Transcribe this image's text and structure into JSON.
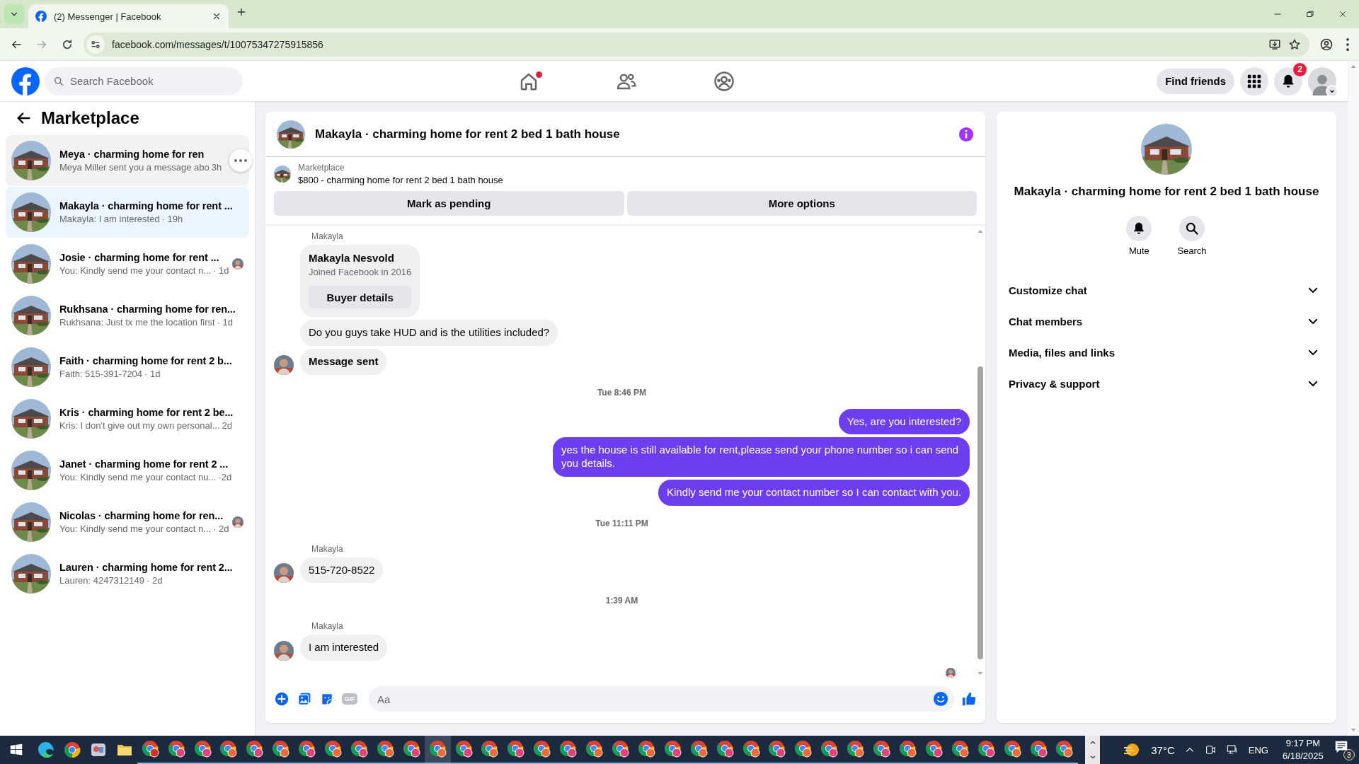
{
  "browser": {
    "tab_title": "(2) Messenger | Facebook",
    "url": "facebook.com/messages/t/10075347275915856"
  },
  "header": {
    "search_placeholder": "Search Facebook",
    "nav": [
      {
        "kind": "home",
        "selected": false,
        "dot": true
      },
      {
        "kind": "friends",
        "selected": false,
        "dot": false
      },
      {
        "kind": "groups",
        "selected": false,
        "dot": false
      }
    ],
    "find_friends": "Find friends",
    "notification_count": "2"
  },
  "sidebar": {
    "title": "Marketplace",
    "conversations": [
      {
        "title": "Meya · charming home for ren",
        "preview": "Meya Miller sent you a message abo",
        "time": "3h",
        "selected": false,
        "hovered": true,
        "seen_avatar": false
      },
      {
        "title": "Makayla · charming home for rent ...",
        "preview": "Makayla: I am interested",
        "time": "· 19h",
        "selected": true,
        "hovered": false,
        "seen_avatar": false
      },
      {
        "title": "Josie · charming home for rent ...",
        "preview": "You: Kindly send me your contact n...",
        "time": "· 1d",
        "selected": false,
        "hovered": false,
        "seen_avatar": true
      },
      {
        "title": "Rukhsana · charming home for ren...",
        "preview": "Rukhsana: Just tx me the location first",
        "time": "· 1d",
        "selected": false,
        "hovered": false,
        "seen_avatar": false
      },
      {
        "title": "Faith · charming home for rent 2 b...",
        "preview": "Faith: 515-391-7204",
        "time": "· 1d",
        "selected": false,
        "hovered": false,
        "seen_avatar": false
      },
      {
        "title": "Kris · charming home for rent 2 be...",
        "preview": "Kris: I don't give out my own personal...",
        "time": "2d",
        "selected": false,
        "hovered": false,
        "seen_avatar": false
      },
      {
        "title": "Janet · charming home for rent 2 ...",
        "preview": "You: Kindly send me your contact nu...",
        "time": "·2d",
        "selected": false,
        "hovered": false,
        "seen_avatar": false
      },
      {
        "title": "Nicolas · charming home for ren...",
        "preview": "You: Kindly send me your contact n...",
        "time": "· 2d",
        "selected": false,
        "hovered": false,
        "seen_avatar": true
      },
      {
        "title": "Lauren · charming home for rent 2...",
        "preview": "Lauren: 4247312149",
        "time": "· 2d",
        "selected": false,
        "hovered": false,
        "seen_avatar": false
      }
    ]
  },
  "chat": {
    "title": "Makayla · charming home for rent 2 bed 1 bath house",
    "listing": {
      "label": "Marketplace",
      "text": "$800 - charming home for rent 2 bed 1 bath house"
    },
    "actions": [
      "Mark as pending",
      "More options"
    ],
    "messages": [
      {
        "kind": "sender",
        "text": "Makayla"
      },
      {
        "kind": "profile_card",
        "name": "Makayla Nesvold",
        "detail": "Joined Facebook in 2016",
        "button": "Buyer details"
      },
      {
        "kind": "incoming",
        "text": "Do you guys take HUD and is the utilities included?",
        "avatar": false,
        "bold": false
      },
      {
        "kind": "incoming",
        "text": "Message sent",
        "avatar": true,
        "bold": true
      },
      {
        "kind": "time",
        "text": "Tue 8:46 PM"
      },
      {
        "kind": "outgoing",
        "text": "Yes, are you interested?"
      },
      {
        "kind": "outgoing",
        "text": "yes the house is still available for rent,please send your phone number so i can send you details."
      },
      {
        "kind": "outgoing",
        "text": "Kindly send me your contact number so I can contact with you."
      },
      {
        "kind": "time",
        "text": "Tue 11:11 PM"
      },
      {
        "kind": "sender",
        "text": "Makayla"
      },
      {
        "kind": "incoming",
        "text": "515-720-8522",
        "avatar": true,
        "bold": false
      },
      {
        "kind": "time",
        "text": "1:39 AM"
      },
      {
        "kind": "sender",
        "text": "Makayla"
      },
      {
        "kind": "incoming",
        "text": "I am interested",
        "avatar": true,
        "bold": false
      },
      {
        "kind": "seen"
      }
    ],
    "composer": {
      "placeholder": "Aa",
      "gif_label": "GIF"
    }
  },
  "info": {
    "name": "Makayla · charming home for rent 2 bed 1 bath house",
    "actions": [
      {
        "kind": "mute",
        "label": "Mute"
      },
      {
        "kind": "search",
        "label": "Search"
      }
    ],
    "sections": [
      {
        "label": "Customize chat",
        "expanded": false
      },
      {
        "label": "Chat members",
        "expanded": false
      },
      {
        "label": "Media, files and links",
        "expanded": false
      },
      {
        "label": "Privacy & support",
        "expanded": false
      }
    ]
  },
  "taskbar": {
    "apps": [
      {
        "kind": "edge",
        "active": false
      },
      {
        "kind": "chrome",
        "active": false
      },
      {
        "kind": "app",
        "active": false
      },
      {
        "kind": "folder",
        "active": false
      },
      {
        "kind": "chrome-profile",
        "active": false,
        "color": "#d93025"
      },
      {
        "kind": "chrome-profile",
        "active": false,
        "color": "#e3427d"
      },
      {
        "kind": "chrome-profile",
        "active": false,
        "color": "#e3427d"
      },
      {
        "kind": "chrome-profile",
        "active": false,
        "color": "#ef6a3a"
      },
      {
        "kind": "chrome-profile",
        "active": false,
        "color": "#e3427d"
      },
      {
        "kind": "chrome-profile",
        "active": false,
        "color": "#ef6a3a"
      },
      {
        "kind": "chrome-profile",
        "active": false,
        "color": "#e3427d"
      },
      {
        "kind": "chrome-profile",
        "active": false,
        "color": "#ef6a3a"
      },
      {
        "kind": "chrome-profile",
        "active": false,
        "color": "#e3427d"
      },
      {
        "kind": "chrome-profile",
        "active": false,
        "color": "#ef6a3a"
      },
      {
        "kind": "chrome-profile",
        "active": false,
        "color": "#e3427d"
      },
      {
        "kind": "chrome-profile",
        "active": true,
        "color": "#ef6a3a"
      },
      {
        "kind": "chrome-profile",
        "active": false,
        "color": "#e3427d"
      },
      {
        "kind": "chrome-profile",
        "active": false,
        "color": "#ef6a3a"
      },
      {
        "kind": "chrome-profile",
        "active": false,
        "color": "#e3427d"
      },
      {
        "kind": "chrome-profile",
        "active": false,
        "color": "#ef6a3a"
      },
      {
        "kind": "chrome-profile",
        "active": false,
        "color": "#e3427d"
      },
      {
        "kind": "chrome-profile",
        "active": false,
        "color": "#ef6a3a"
      },
      {
        "kind": "chrome-profile",
        "active": false,
        "color": "#e3427d"
      },
      {
        "kind": "chrome-profile",
        "active": false,
        "color": "#ef6a3a"
      },
      {
        "kind": "chrome-profile",
        "active": false,
        "color": "#e3427d"
      },
      {
        "kind": "chrome-profile",
        "active": false,
        "color": "#ef6a3a"
      },
      {
        "kind": "chrome-profile",
        "active": false,
        "color": "#e3427d"
      },
      {
        "kind": "chrome-profile",
        "active": false,
        "color": "#ef6a3a"
      },
      {
        "kind": "chrome-profile",
        "active": false,
        "color": "#e3427d"
      },
      {
        "kind": "chrome-profile",
        "active": false,
        "color": "#ef6a3a"
      },
      {
        "kind": "chrome-profile",
        "active": false,
        "color": "#e3427d"
      },
      {
        "kind": "chrome-profile",
        "active": false,
        "color": "#ef6a3a"
      },
      {
        "kind": "chrome-profile",
        "active": false,
        "color": "#e3427d"
      },
      {
        "kind": "chrome-profile",
        "active": false,
        "color": "#ef6a3a"
      },
      {
        "kind": "chrome-profile",
        "active": false,
        "color": "#e3427d"
      },
      {
        "kind": "chrome-profile",
        "active": false,
        "color": "#ef6a3a"
      },
      {
        "kind": "chrome-profile",
        "active": false,
        "color": "#e3427d"
      },
      {
        "kind": "chrome-profile",
        "active": false,
        "color": "#ef6a3a"
      },
      {
        "kind": "chrome-profile",
        "active": false,
        "color": "#e3427d"
      },
      {
        "kind": "chrome-profile",
        "active": false,
        "color": "#ef6a3a"
      }
    ],
    "weather": "37°C",
    "language": "ENG",
    "time": "9:17 PM",
    "date": "6/18/2025",
    "notification_count": "3"
  }
}
